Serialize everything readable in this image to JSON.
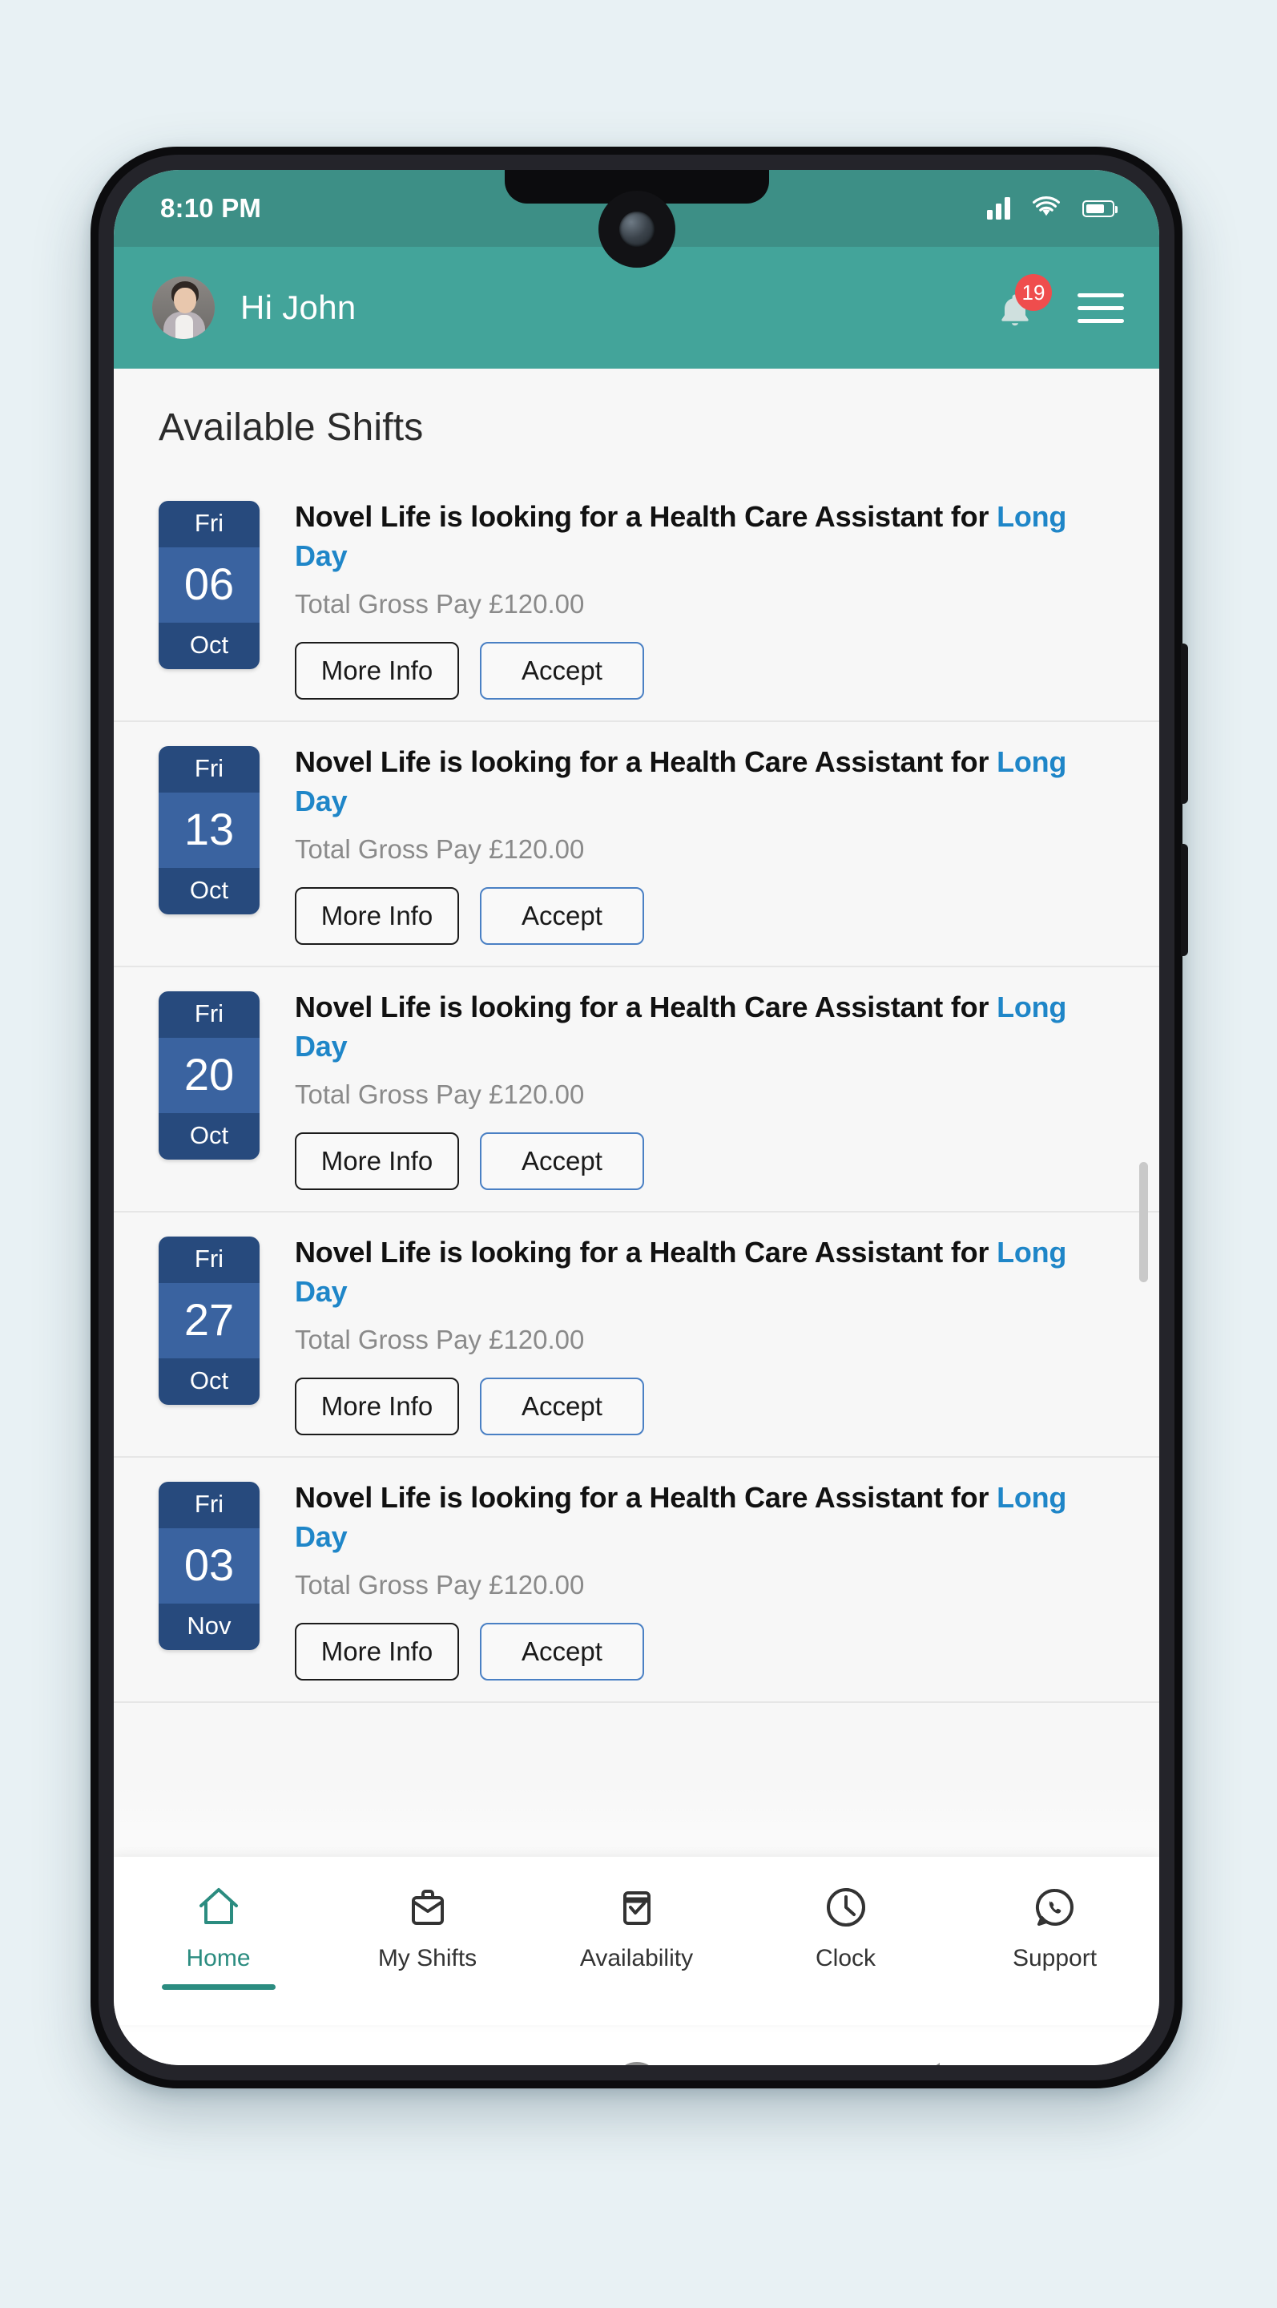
{
  "status_bar": {
    "time": "8:10 PM",
    "icons": [
      "signal-icon",
      "wifi-icon",
      "battery-icon"
    ]
  },
  "header": {
    "greeting": "Hi John",
    "avatar": "user-avatar",
    "notification_badge": "19",
    "bell_icon": "bell-icon",
    "menu_icon": "hamburger-menu-icon",
    "bg_color": "#43a49a"
  },
  "main": {
    "page_title": "Available Shifts",
    "shifts": [
      {
        "dow": "Fri",
        "day": "06",
        "month": "Oct",
        "title_prefix": "Novel Life is looking for a Health Care Assistant for ",
        "role": "Long Day",
        "pay": "Total Gross Pay £120.00",
        "more_info_label": "More Info",
        "accept_label": "Accept"
      },
      {
        "dow": "Fri",
        "day": "13",
        "month": "Oct",
        "title_prefix": "Novel Life is looking for a Health Care Assistant for ",
        "role": "Long Day",
        "pay": "Total Gross Pay £120.00",
        "more_info_label": "More Info",
        "accept_label": "Accept"
      },
      {
        "dow": "Fri",
        "day": "20",
        "month": "Oct",
        "title_prefix": "Novel Life is looking for a Health Care Assistant for ",
        "role": "Long Day",
        "pay": "Total Gross Pay £120.00",
        "more_info_label": "More Info",
        "accept_label": "Accept"
      },
      {
        "dow": "Fri",
        "day": "27",
        "month": "Oct",
        "title_prefix": "Novel Life is looking for a Health Care Assistant for ",
        "role": "Long Day",
        "pay": "Total Gross Pay £120.00",
        "more_info_label": "More Info",
        "accept_label": "Accept"
      },
      {
        "dow": "Fri",
        "day": "03",
        "month": "Nov",
        "title_prefix": "Novel Life is looking for a Health Care Assistant for ",
        "role": "Long Day",
        "pay": "Total Gross Pay £120.00",
        "more_info_label": "More Info",
        "accept_label": "Accept"
      }
    ],
    "role_color": "#1f86c8",
    "date_chip_color": "#3a63a0",
    "date_chip_header_color": "#274a7d"
  },
  "bottom_nav": {
    "active_color": "#2b8c80",
    "items": [
      {
        "label": "Home",
        "icon": "home-icon",
        "active": true
      },
      {
        "label": "My Shifts",
        "icon": "briefcase-icon",
        "active": false
      },
      {
        "label": "Availability",
        "icon": "calendar-check-icon",
        "active": false
      },
      {
        "label": "Clock",
        "icon": "clock-icon",
        "active": false
      },
      {
        "label": "Support",
        "icon": "whatsapp-phone-icon",
        "active": false
      }
    ]
  },
  "android_nav": {
    "recents": "square-recents-button",
    "home": "circle-home-button",
    "back": "triangle-back-button"
  }
}
